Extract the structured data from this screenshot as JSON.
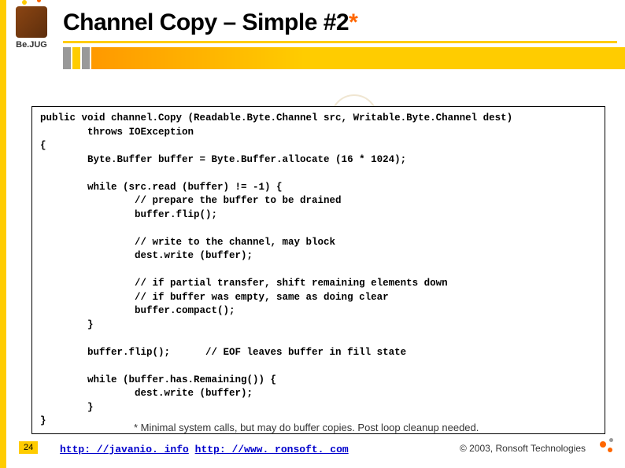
{
  "logo": {
    "text": "Be.JUG"
  },
  "title": {
    "main": "Channel Copy – Simple #2",
    "star": "*"
  },
  "code": "public void channel.Copy (Readable.Byte.Channel src, Writable.Byte.Channel dest)\n        throws IOException\n{\n        Byte.Buffer buffer = Byte.Buffer.allocate (16 * 1024);\n\n        while (src.read (buffer) != -1) {\n                // prepare the buffer to be drained\n                buffer.flip();\n\n                // write to the channel, may block\n                dest.write (buffer);\n\n                // if partial transfer, shift remaining elements down\n                // if buffer was empty, same as doing clear\n                buffer.compact();\n        }\n\n        buffer.flip();      // EOF leaves buffer in fill state\n\n        while (buffer.has.Remaining()) {\n                dest.write (buffer);\n        }\n}",
  "footnote": "* Minimal system calls, but may do buffer copies.  Post loop cleanup needed.",
  "page_number": "24",
  "links": {
    "link1": {
      "text": "http: //javanio. info",
      "sep": "  "
    },
    "link2": {
      "text": "http: //www. ronsoft. com"
    }
  },
  "copyright": "© 2003, Ronsoft Technologies"
}
